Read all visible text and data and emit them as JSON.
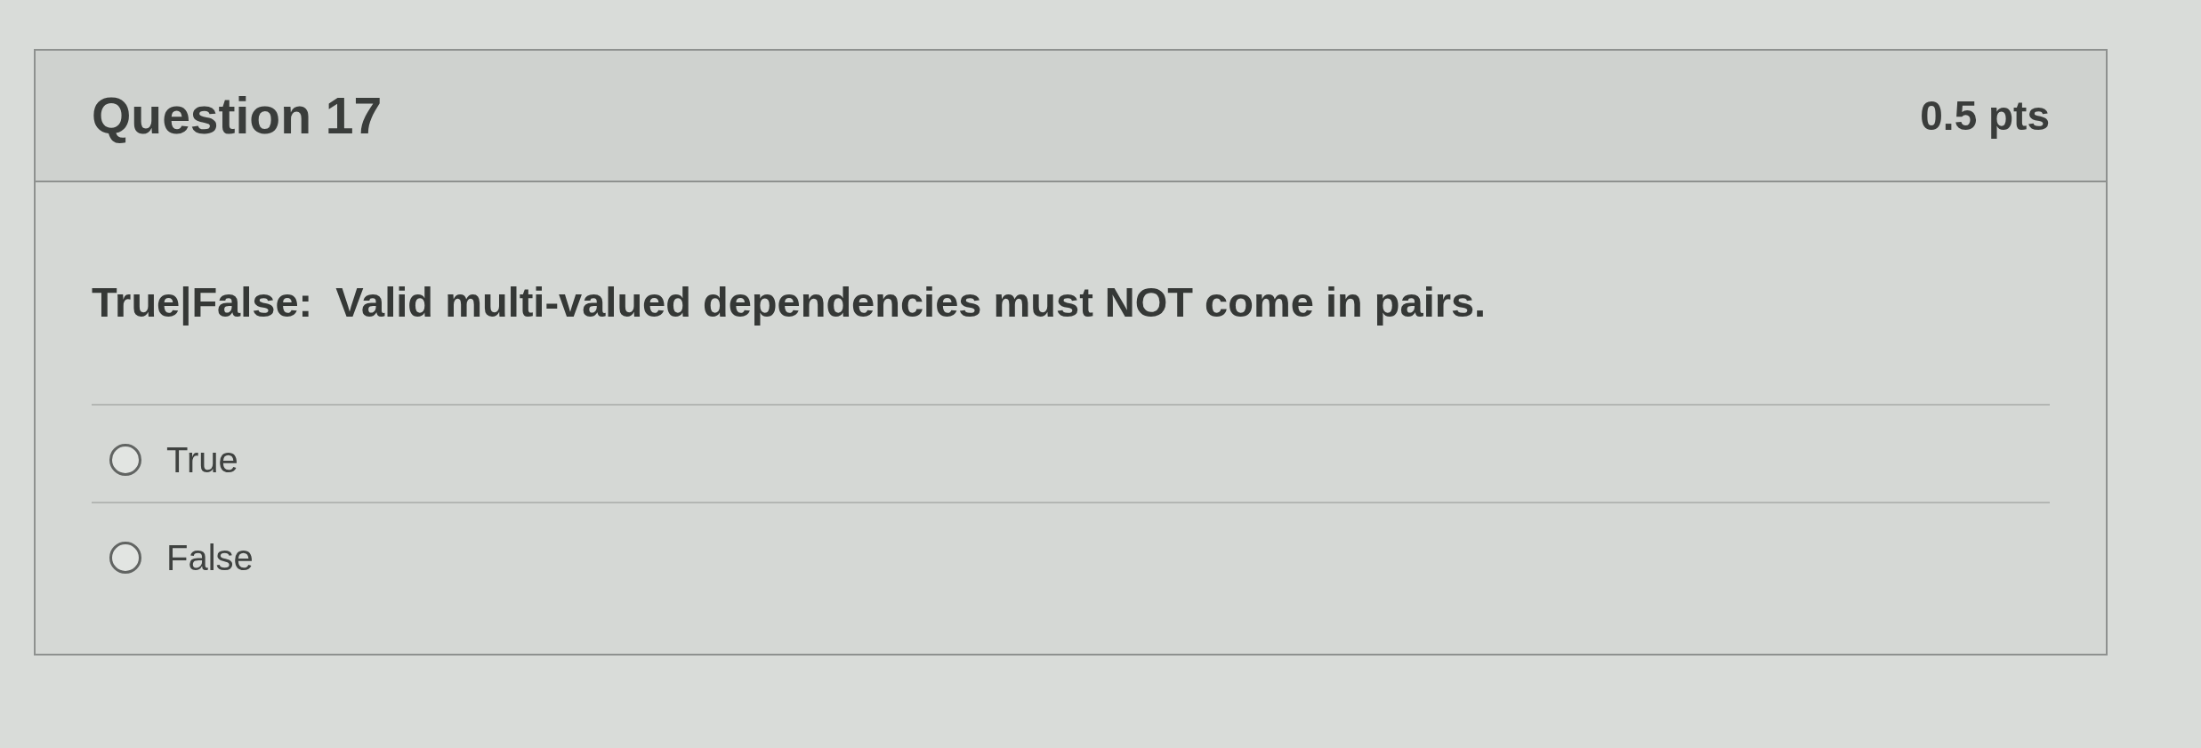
{
  "question": {
    "title": "Question 17",
    "points": "0.5 pts",
    "text": "True|False:  Valid multi-valued dependencies must NOT come in pairs.",
    "answers": [
      {
        "label": "True",
        "selected": false
      },
      {
        "label": "False",
        "selected": false
      }
    ]
  }
}
